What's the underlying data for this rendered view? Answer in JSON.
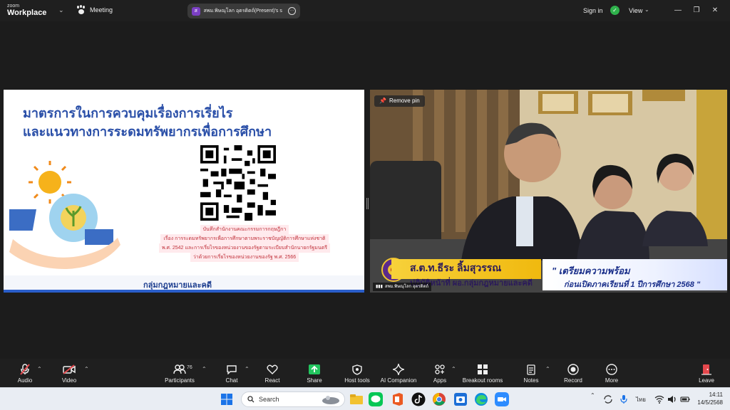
{
  "titlebar": {
    "brand_small": "zoom",
    "brand_main": "Workplace",
    "meeting_label": "Meeting",
    "share_avatar": "ส",
    "share_label": "สพม.พิษณุโลก อุตรดิตถ์(Present)'s s",
    "signin": "Sign in",
    "view": "View"
  },
  "slide": {
    "title_line1": "มาตรการในการควบคุมเรื่องการเรี่ยไร",
    "title_line2": "และแนวทางการระดมทรัพยากรเพื่อการศึกษา",
    "note_lines": [
      "บันทึกสำนักงานคณะกรรมการกฤษฎีกา",
      "เรื่อง การระดมทรัพยากรเพื่อการศึกษาตามพระราชบัญญัติการศึกษาแห่งชาติ",
      "พ.ศ. 2542 และการเรี่ยไรของหน่วยงานของรัฐตามระเบียบสำนักนายกรัฐมนตรี",
      "ว่าด้วยการเรี่ยไรของหน่วยงานของรัฐ พ.ศ. 2566"
    ],
    "footer": "กลุ่มกฎหมายและคดี"
  },
  "video": {
    "pin_label": "Remove pin",
    "name_main": "ส.ต.ท.ธีระ ลิ้มสุวรรณ",
    "name_sub": "ปฏิบัติหน้าที่ ผอ.กลุ่มกฎหมายและคดี",
    "caption_line1": "\" เตรียมความพร้อม",
    "caption_line2": "ก่อนเปิดภาคเรียนที่ 1 ปีการศึกษา 2568 \"",
    "participant_name": "สพม.พิษณุโลก อุตรดิตถ์"
  },
  "toolbar": {
    "audio": "Audio",
    "video": "Video",
    "participants": "Participants",
    "participants_count": "76",
    "chat": "Chat",
    "react": "React",
    "share": "Share",
    "host_tools": "Host tools",
    "ai_companion": "AI Companion",
    "apps": "Apps",
    "breakout": "Breakout rooms",
    "notes": "Notes",
    "record": "Record",
    "more": "More",
    "leave": "Leave"
  },
  "taskbar": {
    "search": "Search",
    "lang": "ไทย",
    "time": "14:11",
    "date": "14/5/2568"
  },
  "colors": {
    "accent_green": "#2fb24c",
    "share_green": "#22c55e",
    "leave_red": "#e5484d",
    "slide_blue": "#2a4fa8"
  }
}
